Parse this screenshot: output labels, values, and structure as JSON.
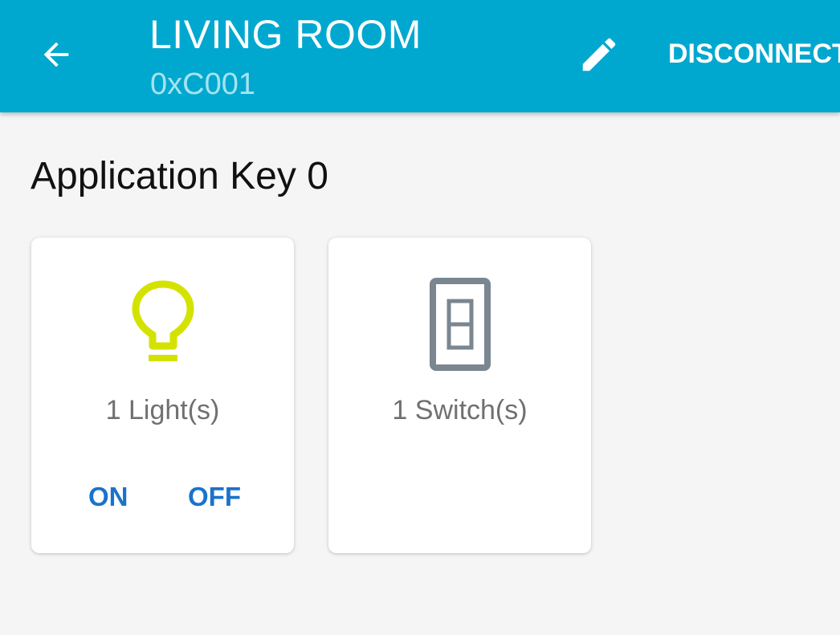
{
  "appbar": {
    "title": "LIVING ROOM",
    "subtitle": "0xC001",
    "back_icon": "arrow-left-icon",
    "edit_icon": "pencil-icon",
    "disconnect_label": "DISCONNECT"
  },
  "section": {
    "title": "Application Key 0"
  },
  "cards": [
    {
      "icon": "lightbulb-icon",
      "label": "1 Light(s)",
      "actions": {
        "on": "ON",
        "off": "OFF"
      }
    },
    {
      "icon": "switch-icon",
      "label": "1 Switch(s)"
    }
  ],
  "colors": {
    "appbar": "#00a8cf",
    "subtitle": "#a6e3f1",
    "light_icon": "#d4e200",
    "switch_icon": "#7a8690",
    "action_text": "#1a73c9",
    "background": "#f5f5f5"
  }
}
